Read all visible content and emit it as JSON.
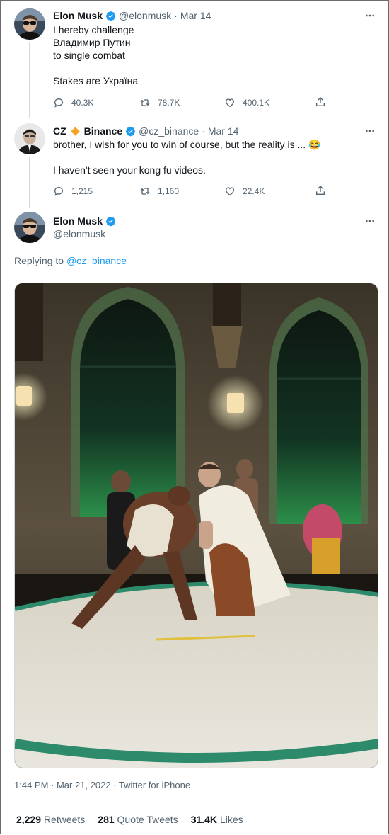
{
  "tweets": [
    {
      "name": "Elon Musk",
      "handle": "@elonmusk",
      "date": "Mar 14",
      "text": "I hereby challenge\nВладимир Путин\nto single combat\n\nStakes are Україна",
      "replies": "40.3K",
      "retweets": "78.7K",
      "likes": "400.1K"
    },
    {
      "name": "CZ",
      "name_suffix": "Binance",
      "handle": "@cz_binance",
      "date": "Mar 14",
      "text": "brother, I wish for you to win of course, but the reality is ... 😂\n\nI haven't seen your kong fu videos.",
      "replies": "1,215",
      "retweets": "1,160",
      "likes": "22.4K"
    }
  ],
  "main_tweet": {
    "name": "Elon Musk",
    "handle": "@elonmusk",
    "replying_prefix": "Replying to",
    "replying_handle": "@cz_binance",
    "timestamp": "1:44 PM · Mar 21, 2022 · Twitter for iPhone",
    "stats": [
      {
        "value": "2,229",
        "label": "Retweets"
      },
      {
        "value": "281",
        "label": "Quote Tweets"
      },
      {
        "value": "31.4K",
        "label": "Likes"
      }
    ]
  },
  "middot": "·",
  "colors": {
    "accent": "#1d9bf0",
    "secondary_text": "#536471",
    "binance_orange": "#f3a424"
  },
  "icons": [
    "verified-badge-icon",
    "more-options-icon",
    "reply-icon",
    "retweet-icon",
    "like-icon",
    "share-icon",
    "binance-diamond-icon"
  ]
}
